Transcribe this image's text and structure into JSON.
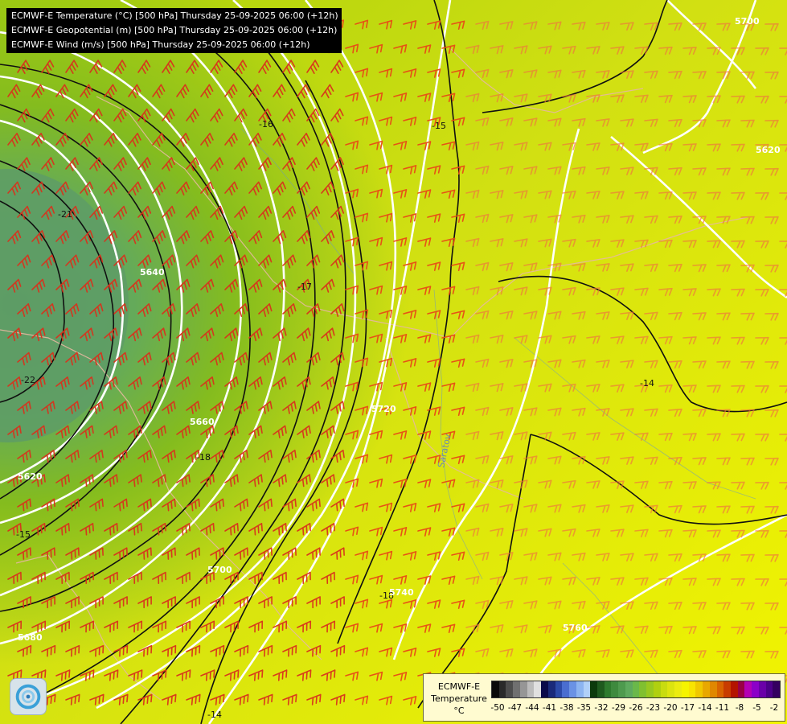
{
  "map": {
    "layers": [
      "ECMWF-E Temperature (°C) [500 hPa] Thursday 25-09-2025 06:00 (+12h)",
      "ECMWF-E Geopotential (m) [500 hPa] Thursday 25-09-2025 06:00 (+12h)",
      "ECMWF-E Wind (m/s) [500 hPa] Thursday 25-09-2025 06:00 (+12h)"
    ],
    "isotherm_labels": [
      "-22",
      "-21",
      "-18",
      "-17",
      "-16",
      "-15",
      "-14",
      "-18",
      "-14",
      "-15"
    ],
    "geopotential_labels": [
      "5620",
      "5640",
      "5660",
      "5680",
      "5700",
      "5720",
      "5740",
      "5620",
      "5700",
      "5760"
    ],
    "city_labels": [
      "Saratov"
    ]
  },
  "legend": {
    "title_lines": [
      "ECMWF-E",
      "Temperature",
      "°C"
    ],
    "ticks": [
      "-50",
      "-47",
      "-44",
      "-41",
      "-38",
      "-35",
      "-32",
      "-29",
      "-26",
      "-23",
      "-20",
      "-17",
      "-14",
      "-11",
      "-8",
      "-5",
      "-2"
    ],
    "colors": [
      "#0a0a0a",
      "#2a2a2a",
      "#4d4d4d",
      "#707070",
      "#969696",
      "#bcbcbc",
      "#e0e0e0",
      "#0a0a4a",
      "#1a2a7a",
      "#2c4aa8",
      "#4a6ed0",
      "#6a92e4",
      "#8cb4f0",
      "#b0d0f8",
      "#0c3a0c",
      "#1e5a1e",
      "#2e7a2e",
      "#3e8a3e",
      "#4e9a4e",
      "#5eaa5e",
      "#6ab84a",
      "#80c030",
      "#98c820",
      "#b0d010",
      "#c8dc10",
      "#dce410",
      "#ecec10",
      "#f6f400",
      "#f8e400",
      "#f0c800",
      "#e8a800",
      "#e08800",
      "#d86400",
      "#c83c00",
      "#b41400",
      "#9a0044",
      "#b400b4",
      "#8c00c8",
      "#6a00a8",
      "#4c0088",
      "#340060"
    ]
  }
}
